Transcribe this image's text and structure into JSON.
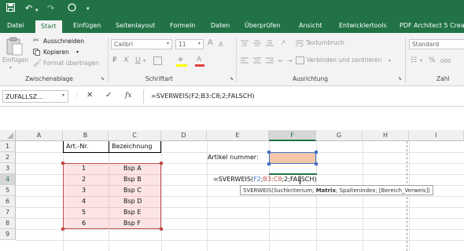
{
  "qat": {
    "save_icon": "save-icon",
    "undo_icon": "undo-icon",
    "redo_icon": "redo-icon",
    "autosave_icon": "circle-icon"
  },
  "tabs": [
    {
      "label": "Datei"
    },
    {
      "label": "Start"
    },
    {
      "label": "Einfügen"
    },
    {
      "label": "Seitenlayout"
    },
    {
      "label": "Formeln"
    },
    {
      "label": "Daten"
    },
    {
      "label": "Überprüfen"
    },
    {
      "label": "Ansicht"
    },
    {
      "label": "Entwicklertools"
    },
    {
      "label": "PDF Architect 5 Crea"
    }
  ],
  "active_tab": "Start",
  "ribbon": {
    "paste_label": "Einfügen",
    "cut_label": "Ausschneiden",
    "copy_label": "Kopieren",
    "format_painter_label": "Format übertragen",
    "clipboard_group": "Zwischenablage",
    "font_name": "Calibri",
    "font_size": "11",
    "font_group": "Schriftart",
    "bold": "F",
    "italic": "K",
    "underline": "U",
    "grow_font": "A",
    "shrink_font": "A",
    "wrap_text_label": "Textumbruch",
    "merge_label": "Verbinden und zentrieren",
    "alignment_group": "Ausrichtung",
    "number_format": "Standard",
    "number_group": "Zahl",
    "percent": "%",
    "thousands": "000"
  },
  "formula_bar": {
    "name_box": "ZUFALLSZ...",
    "cancel": "✕",
    "enter": "✓",
    "fx": "fx",
    "formula": "=SVERWEIS(F2;B3:C8;2;FALSCH)"
  },
  "columns": [
    "A",
    "B",
    "C",
    "D",
    "E",
    "F",
    "G",
    "H",
    "I"
  ],
  "rows": [
    "1",
    "2",
    "3",
    "4",
    "5",
    "6",
    "7",
    "8",
    "9"
  ],
  "cells": {
    "B1": "Art.-Nr.",
    "C1": "Bezeichnung",
    "E2": "Artikel nummer:",
    "table": [
      {
        "nr": "1",
        "bez": "Bsp A"
      },
      {
        "nr": "2",
        "bez": "Bsp B"
      },
      {
        "nr": "3",
        "bez": "Bsp C"
      },
      {
        "nr": "4",
        "bez": "Bsp D"
      },
      {
        "nr": "5",
        "bez": "Bsp E"
      },
      {
        "nr": "6",
        "bez": "Bsp F"
      }
    ],
    "E4_parts": {
      "prefix": "=SVERWEIS(",
      "ref1": "F2",
      "sep1": ";",
      "ref2": "B3:C8",
      "rest": ";2;FALSCH)"
    }
  },
  "tooltip": {
    "fn": "SVERWEIS(",
    "arg1": "Suchkriterium; ",
    "arg2": "Matrix",
    "rest": "; Spaltenindex; [Bereich_Verweis])"
  },
  "colors": {
    "excel_green": "#217346",
    "table_fill": "#fce4e4",
    "table_border": "#c0504d",
    "f2_fill": "#f4c7a8",
    "ref_blue": "#4472c4",
    "ref_red": "#c0504d"
  }
}
